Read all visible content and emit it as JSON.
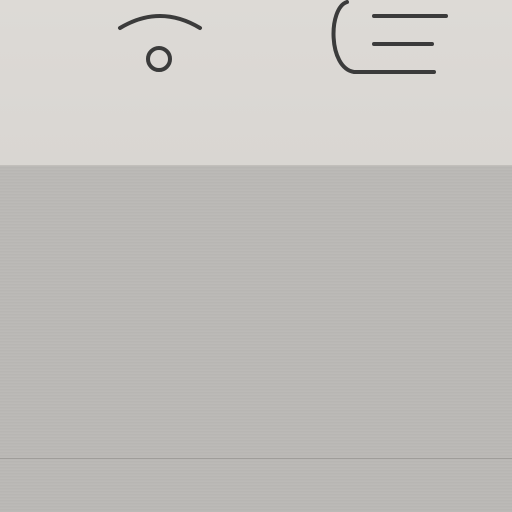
{
  "header": {
    "left_icon": "wifi-icon",
    "right_icon": "menu-icon"
  },
  "colors": {
    "top_bar_bg": "#dddad6",
    "content_bg": "#bbb9b6",
    "icon_stroke": "#3b3b3b",
    "divider": "#9f9d9a"
  }
}
